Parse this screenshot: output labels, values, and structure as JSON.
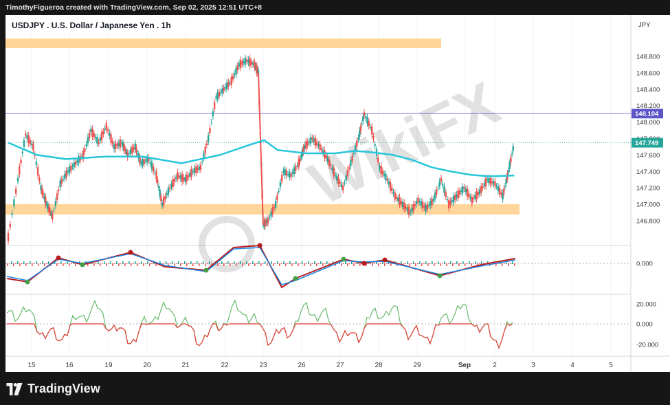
{
  "credit": "TimothyFigueroa created with TradingView.com, Sep 02, 2025 12:51 UTC+8",
  "brand": "TradingView",
  "watermark": "WikiFX",
  "chart_data": {
    "type": "line",
    "title": "USDJPY . U.S. Dollar / Japanese Yen . 1h",
    "currency": "JPY",
    "ylim": [
      146.5,
      148.95
    ],
    "y_ticks": [
      "148.800",
      "148.600",
      "148.400",
      "148.200",
      "148.000",
      "147.800",
      "147.600",
      "147.400",
      "147.200",
      "147.000",
      "146.800"
    ],
    "x_ticks": [
      "15",
      "16",
      "19",
      "20",
      "21",
      "22",
      "23",
      "26",
      "27",
      "28",
      "29",
      "Sep",
      "2",
      "3",
      "4",
      "5"
    ],
    "price_series": [
      {
        "x": 0,
        "y": 146.6
      },
      {
        "x": 0.5,
        "y": 147.3
      },
      {
        "x": 0.9,
        "y": 147.85
      },
      {
        "x": 1.3,
        "y": 147.7
      },
      {
        "x": 1.7,
        "y": 147.2
      },
      {
        "x": 2.0,
        "y": 147.0
      },
      {
        "x": 2.3,
        "y": 146.85
      },
      {
        "x": 2.7,
        "y": 147.25
      },
      {
        "x": 3.1,
        "y": 147.4
      },
      {
        "x": 3.5,
        "y": 147.5
      },
      {
        "x": 3.9,
        "y": 147.6
      },
      {
        "x": 4.3,
        "y": 147.9
      },
      {
        "x": 4.7,
        "y": 147.75
      },
      {
        "x": 5.1,
        "y": 147.95
      },
      {
        "x": 5.5,
        "y": 147.7
      },
      {
        "x": 5.9,
        "y": 147.75
      },
      {
        "x": 6.2,
        "y": 147.6
      },
      {
        "x": 6.6,
        "y": 147.7
      },
      {
        "x": 6.9,
        "y": 147.5
      },
      {
        "x": 7.3,
        "y": 147.55
      },
      {
        "x": 7.7,
        "y": 147.35
      },
      {
        "x": 8.0,
        "y": 147.0
      },
      {
        "x": 8.4,
        "y": 147.2
      },
      {
        "x": 8.8,
        "y": 147.35
      },
      {
        "x": 9.2,
        "y": 147.3
      },
      {
        "x": 9.6,
        "y": 147.4
      },
      {
        "x": 10.0,
        "y": 147.45
      },
      {
        "x": 10.4,
        "y": 147.8
      },
      {
        "x": 10.8,
        "y": 148.3
      },
      {
        "x": 11.2,
        "y": 148.4
      },
      {
        "x": 11.6,
        "y": 148.5
      },
      {
        "x": 12.0,
        "y": 148.7
      },
      {
        "x": 12.4,
        "y": 148.75
      },
      {
        "x": 12.8,
        "y": 148.7
      },
      {
        "x": 13.0,
        "y": 148.6
      },
      {
        "x": 13.25,
        "y": 146.75
      },
      {
        "x": 13.5,
        "y": 146.8
      },
      {
        "x": 13.9,
        "y": 147.0
      },
      {
        "x": 14.3,
        "y": 147.4
      },
      {
        "x": 14.7,
        "y": 147.35
      },
      {
        "x": 15.1,
        "y": 147.5
      },
      {
        "x": 15.4,
        "y": 147.7
      },
      {
        "x": 15.8,
        "y": 147.8
      },
      {
        "x": 16.2,
        "y": 147.7
      },
      {
        "x": 16.6,
        "y": 147.55
      },
      {
        "x": 17.0,
        "y": 147.35
      },
      {
        "x": 17.4,
        "y": 147.2
      },
      {
        "x": 17.8,
        "y": 147.5
      },
      {
        "x": 18.2,
        "y": 147.8
      },
      {
        "x": 18.5,
        "y": 148.1
      },
      {
        "x": 18.9,
        "y": 147.9
      },
      {
        "x": 19.3,
        "y": 147.45
      },
      {
        "x": 19.7,
        "y": 147.3
      },
      {
        "x": 20.1,
        "y": 147.1
      },
      {
        "x": 20.5,
        "y": 147.0
      },
      {
        "x": 20.9,
        "y": 146.9
      },
      {
        "x": 21.3,
        "y": 147.05
      },
      {
        "x": 21.7,
        "y": 146.95
      },
      {
        "x": 22.1,
        "y": 147.05
      },
      {
        "x": 22.5,
        "y": 147.3
      },
      {
        "x": 22.9,
        "y": 147.0
      },
      {
        "x": 23.3,
        "y": 147.1
      },
      {
        "x": 23.7,
        "y": 147.2
      },
      {
        "x": 24.1,
        "y": 147.05
      },
      {
        "x": 24.5,
        "y": 147.15
      },
      {
        "x": 24.9,
        "y": 147.3
      },
      {
        "x": 25.3,
        "y": 147.25
      },
      {
        "x": 25.7,
        "y": 147.1
      },
      {
        "x": 26.0,
        "y": 147.4
      },
      {
        "x": 26.3,
        "y": 147.749
      }
    ],
    "ma_series": [
      {
        "x": 0,
        "y": 147.75
      },
      {
        "x": 1.5,
        "y": 147.6
      },
      {
        "x": 3,
        "y": 147.55
      },
      {
        "x": 5,
        "y": 147.58
      },
      {
        "x": 7,
        "y": 147.58
      },
      {
        "x": 9,
        "y": 147.5
      },
      {
        "x": 11,
        "y": 147.6
      },
      {
        "x": 12.5,
        "y": 147.72
      },
      {
        "x": 13.3,
        "y": 147.78
      },
      {
        "x": 14,
        "y": 147.66
      },
      {
        "x": 15.5,
        "y": 147.62
      },
      {
        "x": 17,
        "y": 147.62
      },
      {
        "x": 18,
        "y": 147.65
      },
      {
        "x": 19,
        "y": 147.63
      },
      {
        "x": 20,
        "y": 147.6
      },
      {
        "x": 21,
        "y": 147.54
      },
      {
        "x": 22,
        "y": 147.45
      },
      {
        "x": 23,
        "y": 147.4
      },
      {
        "x": 24,
        "y": 147.36
      },
      {
        "x": 25,
        "y": 147.34
      },
      {
        "x": 26.3,
        "y": 147.35
      }
    ],
    "horizontal_levels": [
      {
        "value": 148.104,
        "label": "148.104"
      }
    ],
    "last_price": {
      "value": 147.749,
      "label": "147.749"
    },
    "zones": [
      {
        "from": 148.84,
        "to": 148.96,
        "x_end": 22.5
      },
      {
        "from": 146.89,
        "to": 147.0,
        "x_end": 26.5
      }
    ],
    "oscillator1": {
      "ticks": [
        "0.000"
      ],
      "zero": 0
    },
    "oscillator2": {
      "ticks": [
        "20.000",
        "0.000",
        "-20.000"
      ]
    }
  }
}
